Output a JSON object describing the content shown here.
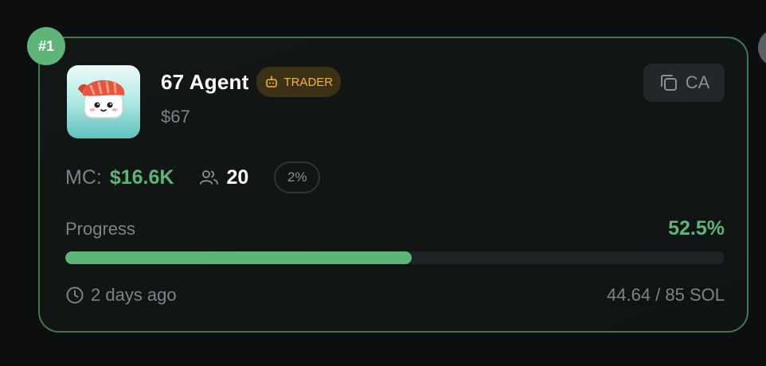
{
  "card": {
    "rank": "#1",
    "name": "67 Agent",
    "tag": {
      "label": "TRADER",
      "icon": "bot-icon",
      "color": "#f1b72f"
    },
    "ticker": "$67",
    "ca_button": {
      "label": "CA",
      "icon": "copy-icon"
    },
    "market_cap": {
      "label": "MC:",
      "value": "$16.6K"
    },
    "holders": {
      "icon": "users-icon",
      "count": "20"
    },
    "percent_pill": "2%",
    "progress": {
      "label": "Progress",
      "value_text": "52.5%",
      "fraction": 0.525
    },
    "age": {
      "icon": "clock-icon",
      "text": "2 days ago"
    },
    "sol": "44.64 / 85 SOL"
  },
  "colors": {
    "accent_green": "#5fb47a",
    "card_border": "#3f7a4e",
    "tag_text": "#f1b72f"
  }
}
